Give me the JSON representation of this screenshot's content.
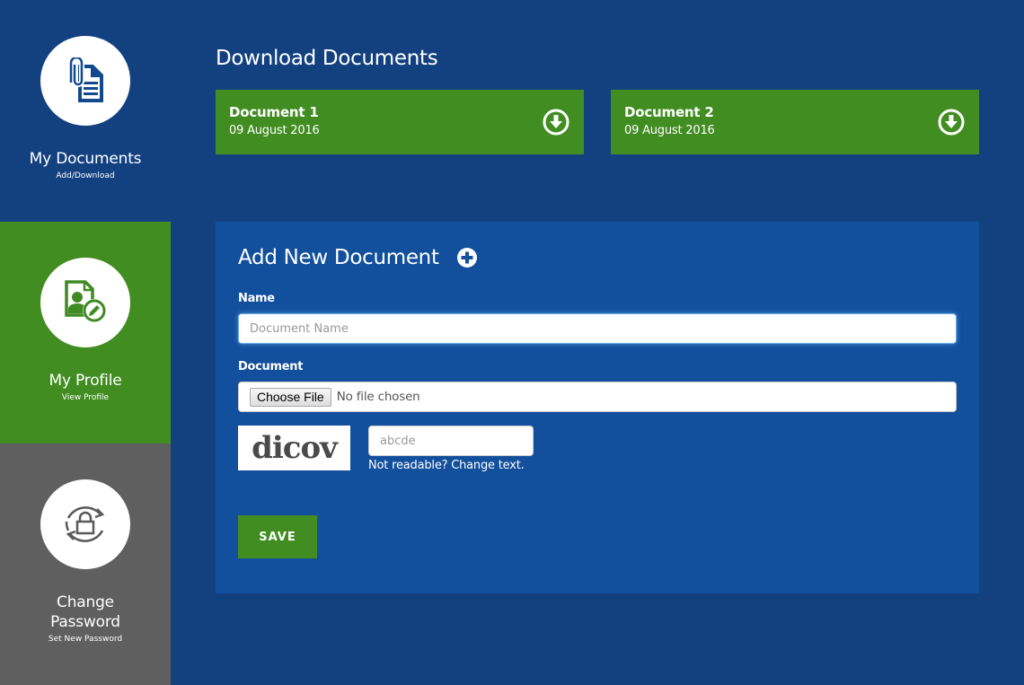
{
  "sidebar": {
    "items": [
      {
        "title": "My Documents",
        "subtitle": "Add/Download",
        "icon": "document-attachment-icon",
        "active": false
      },
      {
        "title": "My Profile",
        "subtitle": "View Profile",
        "icon": "profile-edit-icon",
        "active": true
      },
      {
        "title": "Change Password",
        "subtitle": "Set New Password",
        "icon": "lock-refresh-icon",
        "active": false
      }
    ]
  },
  "download": {
    "title": "Download Documents",
    "documents": [
      {
        "name": "Document 1",
        "date": "09 August 2016",
        "icon": "download-circle-icon"
      },
      {
        "name": "Document 2",
        "date": "09 August 2016",
        "icon": "download-circle-icon"
      }
    ]
  },
  "form": {
    "title": "Add New Document",
    "add_icon": "plus-circle-icon",
    "name_label": "Name",
    "name_placeholder": "Document Name",
    "name_value": "",
    "document_label": "Document",
    "file_button": "Choose File",
    "file_status": "No file chosen",
    "captcha_text": "dicov",
    "captcha_placeholder": "abcde",
    "captcha_value": "",
    "change_text": "Not readable? Change text.",
    "save_label": "SAVE"
  },
  "colors": {
    "background": "#134180",
    "panel": "#124f9d",
    "green": "#428d22",
    "gray": "#5f5f5f"
  }
}
